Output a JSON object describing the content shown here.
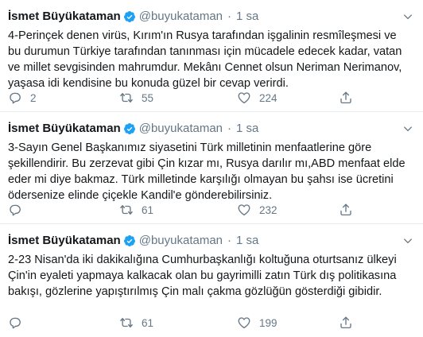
{
  "tweets": [
    {
      "name": "İsmet Büyükataman",
      "handle": "@buyukataman",
      "separator": "·",
      "time": "1 sa",
      "text": "4-Perinçek denen virüs, Kırım'ın Rusya tarafından işgalinin resmîleşmesi ve bu durumun Türkiye tarafından tanınması için mücadele edecek kadar, vatan ve millet sevgisinden mahrumdur. Mekânı Cennet olsun Neriman Nerimanov, yaşasa idi kendisine bu konuda güzel bir cevap verirdi.",
      "replies": "2",
      "retweets": "55",
      "likes": "224"
    },
    {
      "name": "İsmet Büyükataman",
      "handle": "@buyukataman",
      "separator": "·",
      "time": "1 sa",
      "text": "3-Sayın Genel Başkanımız siyasetini Türk milletinin menfaatlerine göre şekillendirir. Bu zerzevat gibi Çin kızar mı, Rusya darılır mı,ABD menfaat elde eder mi diye bakmaz. Türk milletinde karşılığı olmayan bu şahsı ise ücretini ödersenize elinde çiçekle Kandil'e gönderebilirsiniz.",
      "replies": "",
      "retweets": "61",
      "likes": "232"
    },
    {
      "name": "İsmet Büyükataman",
      "handle": "@buyukataman",
      "separator": "·",
      "time": "1 sa",
      "text": "2-23 Nisan'da iki dakikalığına Cumhurbaşkanlığı koltuğuna oturtsanız ülkeyi Çin'in eyaleti yapmaya kalkacak olan bu gayrimilli zatın Türk dış politikasına bakışı, gözlerine yapıştırılmış Çin malı çakma gözlüğün gösterdiği gibidir.",
      "replies": "",
      "retweets": "61",
      "likes": "199"
    }
  ],
  "colors": {
    "text": "#14171a",
    "secondary": "#657786",
    "verified": "#1da1f2",
    "divider": "#e6ecf0"
  },
  "icons": {
    "verified": "verified-badge-icon",
    "menu": "chevron-down-icon",
    "reply": "reply-icon",
    "retweet": "retweet-icon",
    "like": "heart-icon",
    "share": "share-icon"
  }
}
